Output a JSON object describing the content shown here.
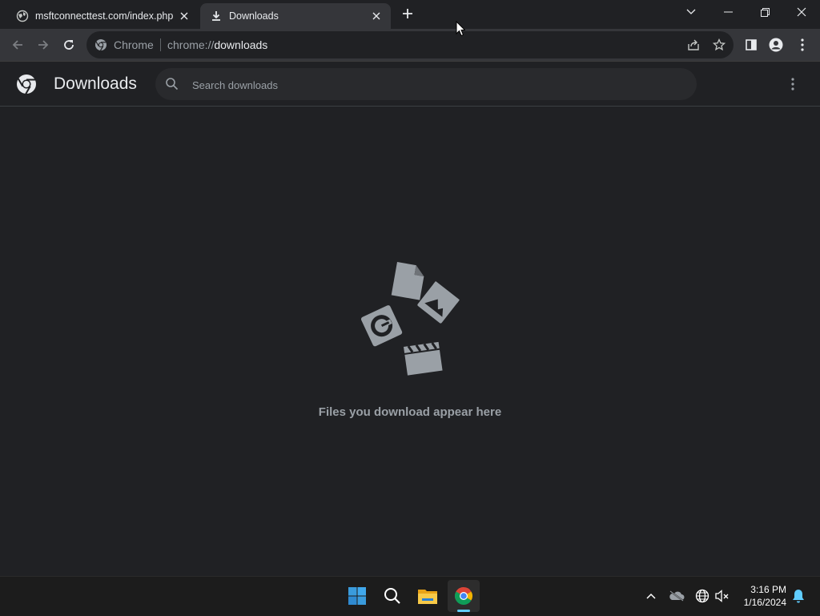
{
  "tabs": [
    {
      "title": "msftconnecttest.com/index.php",
      "icon": "globe-icon"
    },
    {
      "title": "Downloads",
      "icon": "download-icon",
      "active": true
    }
  ],
  "omnibox": {
    "chip": "Chrome",
    "url_prefix": "chrome://",
    "url_host": "downloads"
  },
  "page": {
    "title": "Downloads",
    "search_placeholder": "Search downloads",
    "empty_message": "Files you download appear here"
  },
  "taskbar": {
    "time": "3:16 PM",
    "date": "1/16/2024"
  },
  "colors": {
    "background": "#202124",
    "toolbar": "#35363a",
    "accent": "#60cdff"
  }
}
